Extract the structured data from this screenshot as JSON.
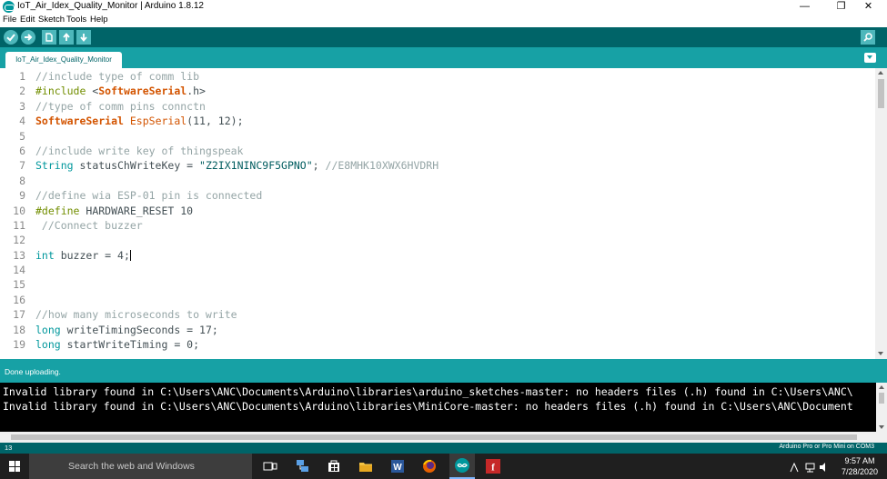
{
  "window": {
    "title": "IoT_Air_Idex_Quality_Monitor | Arduino 1.8.12",
    "minimize": "—",
    "maximize": "❐",
    "close": "✕"
  },
  "menu": [
    "File",
    "Edit",
    "Sketch",
    "Tools",
    "Help"
  ],
  "toolbar": {
    "icons": [
      "verify-icon",
      "upload-icon",
      "new-icon",
      "open-icon",
      "save-icon",
      "serial-monitor-icon"
    ]
  },
  "tabs": [
    {
      "label": "IoT_Air_Idex_Quality_Monitor"
    }
  ],
  "editor": {
    "lines": [
      {
        "n": "1",
        "tokens": [
          {
            "t": "//include type of comm lib",
            "c": "comment"
          }
        ]
      },
      {
        "n": "2",
        "tokens": [
          {
            "t": "#include",
            "c": "pp"
          },
          {
            "t": " <",
            "c": ""
          },
          {
            "t": "SoftwareSerial",
            "c": "lib"
          },
          {
            "t": ".h>",
            "c": ""
          }
        ]
      },
      {
        "n": "3",
        "tokens": [
          {
            "t": "//type of comm pins connctn",
            "c": "comment"
          }
        ]
      },
      {
        "n": "4",
        "tokens": [
          {
            "t": "SoftwareSerial",
            "c": "lib"
          },
          {
            "t": " ",
            "c": ""
          },
          {
            "t": "EspSerial",
            "c": "fn"
          },
          {
            "t": "(11, 12);",
            "c": ""
          }
        ]
      },
      {
        "n": "5",
        "tokens": []
      },
      {
        "n": "6",
        "tokens": [
          {
            "t": "//include write key of thingspeak",
            "c": "comment"
          }
        ]
      },
      {
        "n": "7",
        "tokens": [
          {
            "t": "String",
            "c": "key"
          },
          {
            "t": " statusChWriteKey = ",
            "c": ""
          },
          {
            "t": "\"Z2IX1NINC9F5GPNO\"",
            "c": "str"
          },
          {
            "t": "; ",
            "c": ""
          },
          {
            "t": "//E8MHK10XWX6HVDRH",
            "c": "comment"
          }
        ]
      },
      {
        "n": "8",
        "tokens": []
      },
      {
        "n": "9",
        "tokens": [
          {
            "t": "//define wia ESP-01 pin is connected",
            "c": "comment"
          }
        ]
      },
      {
        "n": "10",
        "tokens": [
          {
            "t": "#define",
            "c": "pp"
          },
          {
            "t": " HARDWARE_RESET 10",
            "c": ""
          }
        ]
      },
      {
        "n": "11",
        "tokens": [
          {
            "t": " //Connect buzzer",
            "c": "comment"
          }
        ]
      },
      {
        "n": "12",
        "tokens": []
      },
      {
        "n": "13",
        "tokens": [
          {
            "t": "int",
            "c": "key"
          },
          {
            "t": " buzzer = 4;",
            "c": ""
          }
        ],
        "cursor": true
      },
      {
        "n": "14",
        "tokens": []
      },
      {
        "n": "15",
        "tokens": []
      },
      {
        "n": "16",
        "tokens": []
      },
      {
        "n": "17",
        "tokens": [
          {
            "t": "//how many microseconds to write",
            "c": "comment"
          }
        ]
      },
      {
        "n": "18",
        "tokens": [
          {
            "t": "long",
            "c": "key"
          },
          {
            "t": " writeTimingSeconds = 17;",
            "c": ""
          }
        ]
      },
      {
        "n": "19",
        "tokens": [
          {
            "t": "long",
            "c": "key"
          },
          {
            "t": " startWriteTiming = 0;",
            "c": ""
          }
        ]
      }
    ]
  },
  "status": {
    "message": "Done uploading."
  },
  "console": {
    "lines": [
      "Invalid library found in C:\\Users\\ANC\\Documents\\Arduino\\libraries\\arduino_sketches-master: no headers files (.h) found in C:\\Users\\ANC\\",
      "Invalid library found in C:\\Users\\ANC\\Documents\\Arduino\\libraries\\MiniCore-master: no headers files (.h) found in C:\\Users\\ANC\\Document"
    ]
  },
  "footer": {
    "line_number": "13",
    "board": "Arduino Pro or Pro Mini on COM3"
  },
  "taskbar": {
    "search_placeholder": "Search the web and Windows",
    "apps": [
      "task-view-icon",
      "network-app-icon",
      "store-icon",
      "file-explorer-icon",
      "word-icon",
      "firefox-icon",
      "arduino-icon",
      "red-app-icon"
    ],
    "time": "9:57 AM",
    "date": "7/28/2020"
  },
  "colors": {
    "toolbar": "#006468",
    "tabstrip": "#17a1a5",
    "accent": "#00979c"
  }
}
